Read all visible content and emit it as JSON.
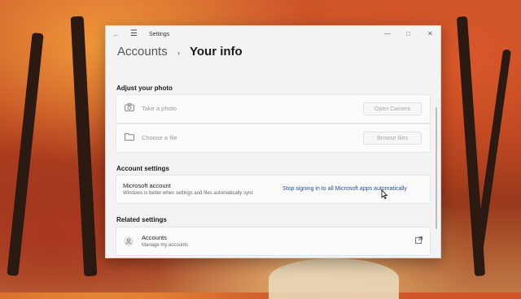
{
  "window": {
    "title": "Settings",
    "back_icon": "back-arrow-icon",
    "menu_icon": "hamburger-menu-icon",
    "controls": [
      "minimize-icon",
      "maximize-icon",
      "close-icon"
    ]
  },
  "breadcrumb": {
    "parent": "Accounts",
    "separator": "›",
    "current": "Your info"
  },
  "adjust_photo": {
    "title": "Adjust your photo",
    "rows": [
      {
        "icon": "camera-icon",
        "label": "Take a photo",
        "button": "Open Camera"
      },
      {
        "icon": "folder-icon",
        "label": "Choose a file",
        "button": "Browse files"
      }
    ]
  },
  "account_settings": {
    "title": "Account settings",
    "microsoft_account": {
      "title": "Microsoft account",
      "subtitle": "Windows is better when settings and files automatically sync",
      "link": "Stop signing in to all Microsoft apps automatically"
    }
  },
  "related_settings": {
    "title": "Related settings",
    "items": [
      {
        "icon": "person-icon",
        "title": "Accounts",
        "subtitle": "Manage my accounts",
        "trailing_icon": "external-link-icon"
      }
    ]
  },
  "colors": {
    "link": "#1f4f9a",
    "window_bg": "#f3f3f3"
  }
}
